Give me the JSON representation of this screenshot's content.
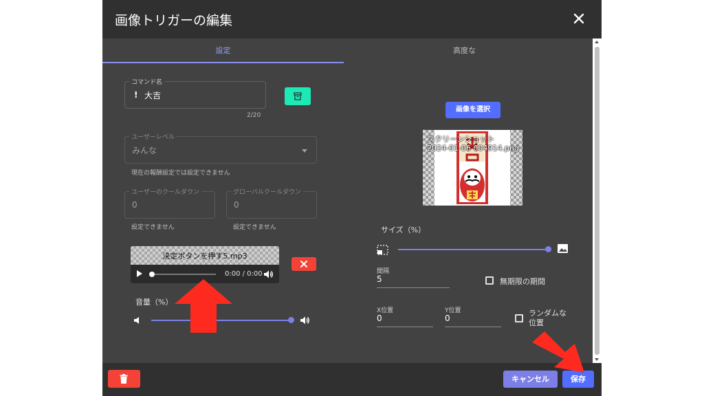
{
  "dialog": {
    "title": "画像トリガーの編集",
    "tabs": [
      {
        "label": "設定",
        "active": true
      },
      {
        "label": "高度な",
        "active": false
      }
    ]
  },
  "left": {
    "command": {
      "label": "コマンド名",
      "prefix": "!",
      "value": "大吉",
      "counter": "2/20"
    },
    "user_level": {
      "label": "ユーザーレベル",
      "value": "みんな",
      "hint": "現在の報酬設定では設定できません"
    },
    "user_cooldown": {
      "label": "ユーザーのクールダウン",
      "value": "0",
      "hint": "設定できません"
    },
    "global_cooldown": {
      "label": "グローバルクールダウン",
      "value": "0",
      "hint": "設定できません"
    },
    "audio": {
      "filename": "決定ボタンを押す5.mp3",
      "time": "0:00 / 0:00"
    },
    "volume": {
      "label": "音量（%）",
      "value": 100
    }
  },
  "right": {
    "select_image_label": "画像を選択",
    "preview_caption_line1": "スクリーンショット",
    "preview_caption_line2": "2024-01-06 004914.png",
    "size": {
      "label": "サイズ（%）",
      "value": 100
    },
    "interval": {
      "label": "間隔",
      "value": "5"
    },
    "unlimited_label": "無期限の期間",
    "x_pos": {
      "label": "X位置",
      "value": "0"
    },
    "y_pos": {
      "label": "Y位置",
      "value": "0"
    },
    "random_position_label_line1": "ランダムな",
    "random_position_label_line2": "位置"
  },
  "footer": {
    "cancel_label": "キャンセル",
    "save_label": "保存"
  },
  "colors": {
    "accent": "#7c80e6",
    "primary_button": "#536dfe",
    "danger": "#f44336",
    "teal": "#1de9b6",
    "dialog_bg": "#424242",
    "titlebar_bg": "#303030",
    "annotation_arrow": "#ff2a1f"
  },
  "icons": {
    "close": "close-icon",
    "archive": "archive-icon",
    "dropdown": "dropdown-arrow-icon",
    "play": "play-icon",
    "volume": "volume-icon",
    "delete": "trash-icon",
    "image_small": "image-small-icon",
    "image_large": "image-large-icon"
  }
}
